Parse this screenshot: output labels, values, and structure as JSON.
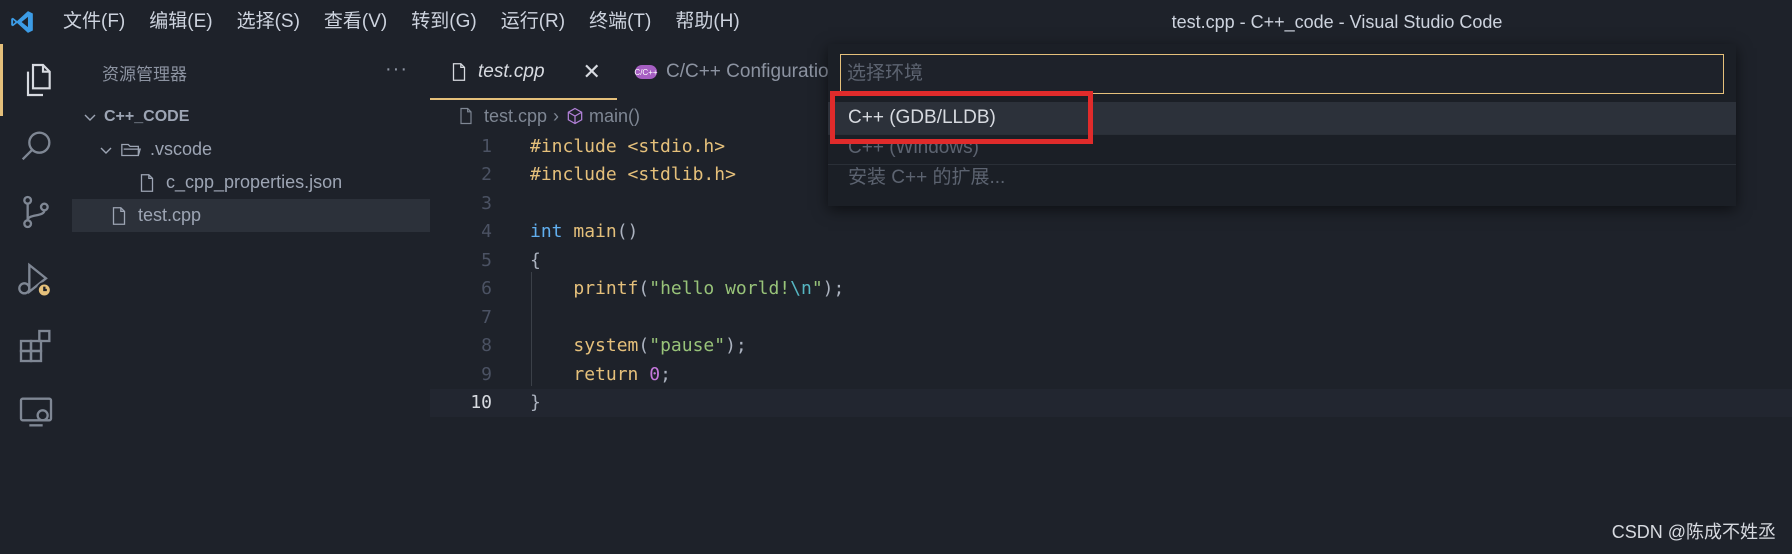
{
  "titlebar": {
    "menu": [
      "文件(F)",
      "编辑(E)",
      "选择(S)",
      "查看(V)",
      "转到(G)",
      "运行(R)",
      "终端(T)",
      "帮助(H)"
    ],
    "title": "test.cpp - C++_code - Visual Studio Code"
  },
  "activitybar": {
    "items": [
      "explorer-icon",
      "search-icon",
      "source-control-icon",
      "run-debug-icon",
      "extensions-icon",
      "remote-explorer-icon"
    ],
    "accent": "#e5c07b"
  },
  "sidebar": {
    "title": "资源管理器",
    "more": "···",
    "root": "C++_CODE",
    "folder": ".vscode",
    "folder_file": "c_cpp_properties.json",
    "file": "test.cpp"
  },
  "tabs": {
    "active": "test.cpp",
    "close": "✕",
    "inactive_badge": "C/C++",
    "inactive": "C/C++ Configuration"
  },
  "breadcrumb": {
    "file": "test.cpp",
    "sep": "›",
    "symbol": "main()"
  },
  "code": {
    "lines": [
      {
        "n": "1",
        "parts": [
          [
            "kw-inc",
            "#include "
          ],
          [
            "hdr",
            "<stdio.h>"
          ]
        ]
      },
      {
        "n": "2",
        "parts": [
          [
            "kw-inc",
            "#include "
          ],
          [
            "hdr",
            "<stdlib.h>"
          ]
        ]
      },
      {
        "n": "3",
        "parts": []
      },
      {
        "n": "4",
        "parts": [
          [
            "kw",
            "int "
          ],
          [
            "fn",
            "main"
          ],
          [
            "",
            "()"
          ]
        ]
      },
      {
        "n": "5",
        "parts": [
          [
            "",
            "{"
          ]
        ]
      },
      {
        "n": "6",
        "parts": [
          [
            "",
            "    "
          ],
          [
            "fn",
            "printf"
          ],
          [
            "",
            "("
          ],
          [
            "str",
            "\"hello world!"
          ],
          [
            "esc",
            "\\n"
          ],
          [
            "str",
            "\""
          ],
          [
            "",
            ");"
          ]
        ]
      },
      {
        "n": "7",
        "parts": []
      },
      {
        "n": "8",
        "parts": [
          [
            "",
            "    "
          ],
          [
            "fn",
            "system"
          ],
          [
            "",
            "("
          ],
          [
            "str",
            "\"pause\""
          ],
          [
            "",
            ");"
          ]
        ]
      },
      {
        "n": "9",
        "parts": [
          [
            "",
            "    "
          ],
          [
            "ret",
            "return "
          ],
          [
            "num",
            "0"
          ],
          [
            "",
            ";"
          ]
        ]
      },
      {
        "n": "10",
        "parts": [
          [
            "",
            "}"
          ]
        ]
      }
    ]
  },
  "quickpick": {
    "placeholder": "选择环境",
    "items": [
      "C++ (GDB/LLDB)",
      "C++ (Windows)",
      "安装 C++ 的扩展..."
    ],
    "highlight_color": "#e02b2b"
  },
  "watermark": "CSDN @陈成不姓丞"
}
